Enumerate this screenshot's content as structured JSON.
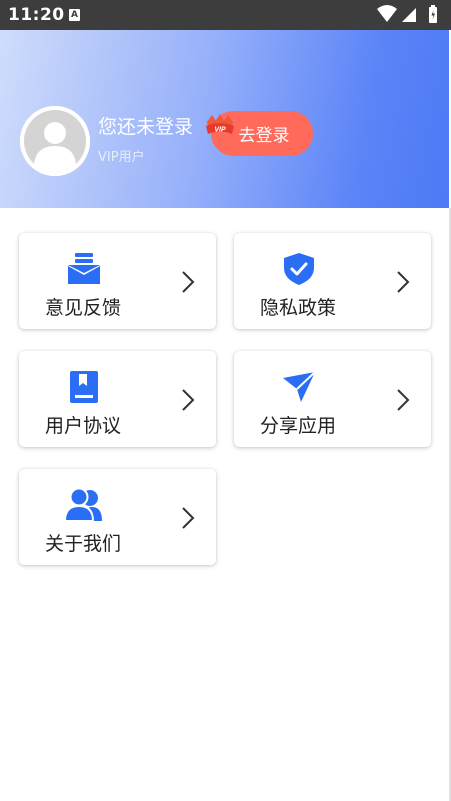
{
  "status_bar": {
    "time": "11:20",
    "notification_letter": "A"
  },
  "header": {
    "login_title": "您还未登录",
    "vip_label": "VIP用户",
    "vip_badge_text": "VIP",
    "login_button": "去登录"
  },
  "menu": {
    "items": [
      {
        "label": "意见反馈",
        "icon": "mail-icon"
      },
      {
        "label": "隐私政策",
        "icon": "shield-check-icon"
      },
      {
        "label": "用户协议",
        "icon": "book-icon"
      },
      {
        "label": "分享应用",
        "icon": "paper-plane-icon"
      },
      {
        "label": "关于我们",
        "icon": "users-icon"
      }
    ]
  },
  "colors": {
    "accent": "#2a6ef5",
    "login_button": "#ff6a5a",
    "header_gradient_start": "#cfdcfb",
    "header_gradient_end": "#4e79f6"
  }
}
